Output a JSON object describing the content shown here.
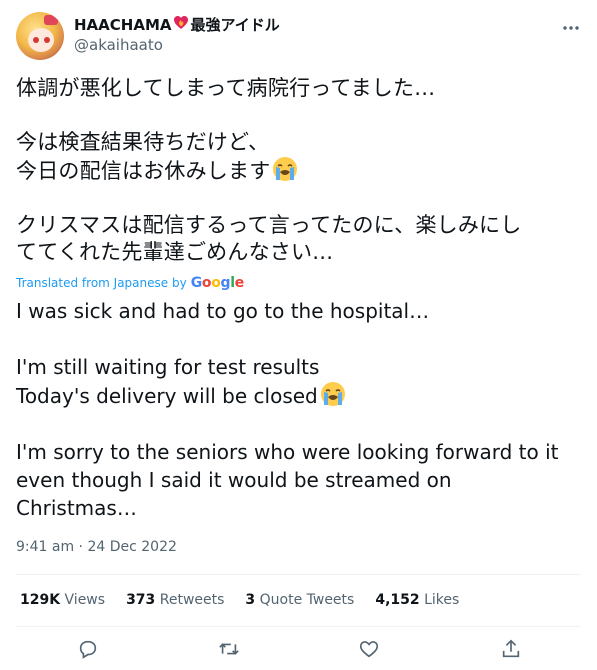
{
  "author": {
    "display_name": "HAACHAMA",
    "name_suffix": "最強アイドル",
    "heart_icon": "heart-on-fire-icon",
    "handle": "@akaihaato"
  },
  "tweet": {
    "original": [
      "体調が悪化してしまって病院行ってました…",
      "今は検査結果待ちだけど、\n今日の配信はお休みします",
      "クリスマスは配信するって言ってたのに、楽しみにし\nててくれた先輩達ごめんなさい…"
    ],
    "emoji": "loudly-crying-face-icon",
    "translated_label": "Translated from Japanese by",
    "translator": "Google",
    "translation": [
      "I was sick and had to go to the hospital…",
      "I'm still waiting for test results\nToday's delivery will be closed",
      "I'm sorry to the seniors who were looking forward to it\neven though I said it would be streamed on\nChristmas…"
    ],
    "timestamp": "9:41 am · 24 Dec 2022"
  },
  "stats": {
    "views_count": "129K",
    "views_label": "Views",
    "retweets_count": "373",
    "retweets_label": "Retweets",
    "quotes_count": "3",
    "quotes_label": "Quote Tweets",
    "likes_count": "4,152",
    "likes_label": "Likes"
  },
  "colors": {
    "accent": "#1d9bf0",
    "secondary_text": "#536471",
    "divider": "#eff3f4"
  }
}
